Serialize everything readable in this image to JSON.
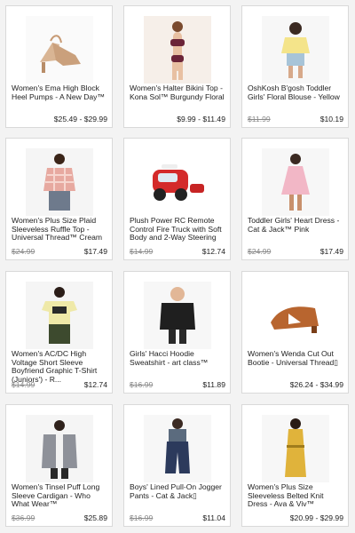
{
  "products": [
    {
      "title": "Women's Ema High Block Heel Pumps - A New Day™",
      "reg_price": "",
      "price": "$25.49 - $29.99",
      "icon": "heel-shoe-icon",
      "swatch": "#d9b594"
    },
    {
      "title": "Women's Halter Bikini Top - Kona Sol™ Burgundy Floral",
      "reg_price": "",
      "price": "$9.99 - $11.49",
      "icon": "bikini-model-icon",
      "swatch": "#6b2438"
    },
    {
      "title": "OshKosh B'gosh Toddler Girls' Floral Blouse - Yellow",
      "reg_price": "$11.99",
      "price": "$10.19",
      "icon": "toddler-blouse-icon",
      "swatch": "#f4e48a"
    },
    {
      "title": "Women's Plus Size Plaid Sleeveless Ruffle Top - Universal Thread™ Cream",
      "reg_price": "$24.99",
      "price": "$17.49",
      "icon": "plaid-top-icon",
      "swatch": "#e7a9a0"
    },
    {
      "title": "Plush Power RC  Remote Control Fire Truck with Soft Body and 2-Way Steering",
      "reg_price": "$14.99",
      "price": "$12.74",
      "icon": "fire-truck-icon",
      "swatch": "#d42a2a"
    },
    {
      "title": "Toddler Girls' Heart Dress - Cat & Jack™ Pink",
      "reg_price": "$24.99",
      "price": "$17.49",
      "icon": "pink-dress-icon",
      "swatch": "#f2b7c6"
    },
    {
      "title": "Women's AC/DC High Voltage Short Sleeve Boyfriend Graphic T-Shirt (Juniors') - R...",
      "reg_price": "$14.99",
      "price": "$12.74",
      "icon": "graphic-tshirt-icon",
      "swatch": "#efe9a8"
    },
    {
      "title": "Girls' Hacci Hoodie Sweatshirt - art class™",
      "reg_price": "$16.99",
      "price": "$11.89",
      "icon": "black-hoodie-icon",
      "swatch": "#1f1f1f"
    },
    {
      "title": "Women's Wenda Cut Out Bootie - Universal Thread▯",
      "reg_price": "",
      "price": "$26.24 - $34.99",
      "icon": "bootie-icon",
      "swatch": "#b8652f"
    },
    {
      "title": "Women's Tinsel Puff Long Sleeve Cardigan - Who What Wear™",
      "reg_price": "$36.99",
      "price": "$25.89",
      "icon": "gray-cardigan-icon",
      "swatch": "#8e9199"
    },
    {
      "title": "Boys' Lined Pull-On Jogger Pants - Cat & Jack▯",
      "reg_price": "$16.99",
      "price": "$11.04",
      "icon": "jogger-pants-icon",
      "swatch": "#2c3a5c"
    },
    {
      "title": "Women's Plus Size Sleeveless Belted Knit Dress - Ava & Viv™",
      "reg_price": "",
      "price": "$20.99 - $29.99",
      "icon": "yellow-dress-icon",
      "swatch": "#e0b33b"
    }
  ]
}
